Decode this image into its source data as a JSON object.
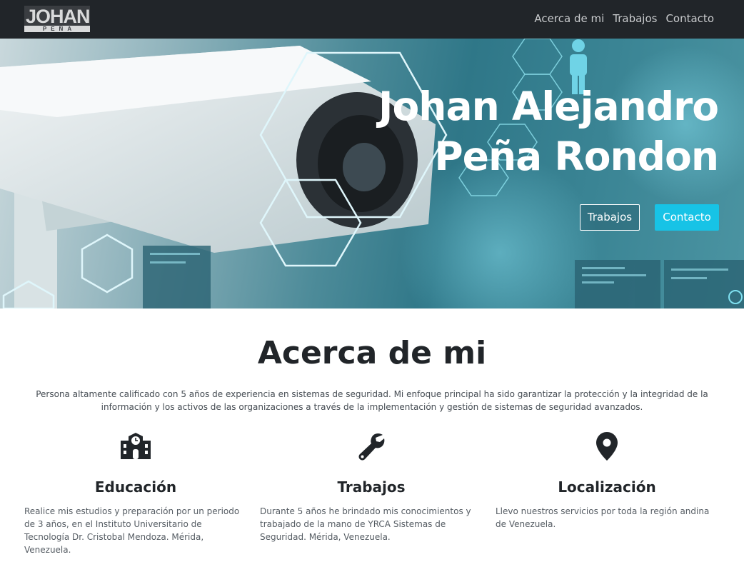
{
  "navbar": {
    "logo": {
      "line1": "JOHAN",
      "line2": "PEÑA"
    },
    "links": [
      "Acerca de mi",
      "Trabajos",
      "Contacto"
    ]
  },
  "hero": {
    "title_line1": "Johan Alejandro",
    "title_line2": "Peña Rondon",
    "btn_trabajos": "Trabajos",
    "btn_contacto": "Contacto",
    "accent_color": "#17c3e6"
  },
  "about": {
    "title": "Acerca de mi",
    "text": "Persona altamente calificado con 5 años de experiencia en sistemas de seguridad. Mi enfoque principal ha sido garantizar la protección y la integridad de la información y los activos de las organizaciones a través de la implementación y gestión de sistemas de seguridad avanzados.",
    "columns": [
      {
        "icon": "school-icon",
        "title": "Educación",
        "text": "Realice mis estudios y preparación por un periodo de 3 años, en el Instituto Universitario de Tecnología Dr. Cristobal Mendoza. Mérida, Venezuela."
      },
      {
        "icon": "wrench-icon",
        "title": "Trabajos",
        "text": "Durante 5 años he brindado mis conocimientos y trabajado de la mano de YRCA Sistemas de Seguridad. Mérida, Venezuela."
      },
      {
        "icon": "map-pin-icon",
        "title": "Localización",
        "text": "Llevo nuestros servicios por toda la región andina de Venezuela."
      }
    ]
  }
}
